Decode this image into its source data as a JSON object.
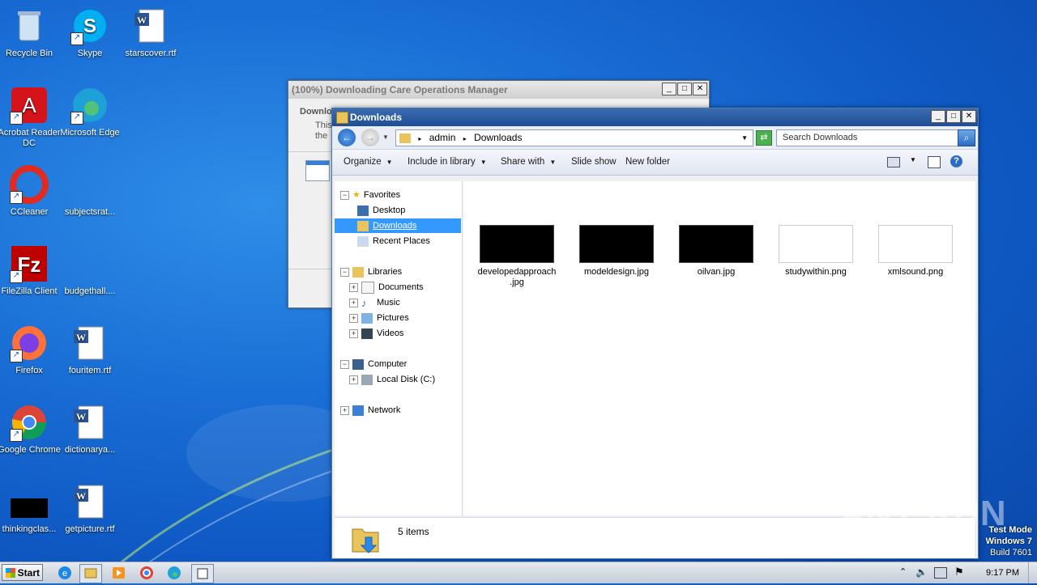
{
  "desktop": {
    "icons": [
      {
        "label": "Recycle Bin"
      },
      {
        "label": "Skype"
      },
      {
        "label": "starscover.rtf"
      },
      {
        "label": "Acrobat Reader DC"
      },
      {
        "label": "Microsoft Edge"
      },
      {
        "label": "CCleaner"
      },
      {
        "label": "subjectsrat..."
      },
      {
        "label": "FileZilla Client"
      },
      {
        "label": "budgethall...."
      },
      {
        "label": "Firefox"
      },
      {
        "label": "fouritem.rtf"
      },
      {
        "label": "Google Chrome"
      },
      {
        "label": "dictionarya..."
      },
      {
        "label": "thinkingclas..."
      },
      {
        "label": "getpicture.rtf"
      }
    ]
  },
  "background_window": {
    "title": "(100%) Downloading Care Operations Manager",
    "line1": "Downlo",
    "line2": "This",
    "line3": "the"
  },
  "explorer": {
    "title": "Downloads",
    "breadcrumb": [
      "admin",
      "Downloads"
    ],
    "search_placeholder": "Search Downloads",
    "commands": {
      "organize": "Organize",
      "include": "Include in library",
      "share": "Share with",
      "slideshow": "Slide show",
      "newfolder": "New folder"
    },
    "nav": {
      "favorites": "Favorites",
      "desktop": "Desktop",
      "downloads": "Downloads",
      "recent": "Recent Places",
      "libraries": "Libraries",
      "documents": "Documents",
      "music": "Music",
      "pictures": "Pictures",
      "videos": "Videos",
      "computer": "Computer",
      "localdisk": "Local Disk (C:)",
      "network": "Network"
    },
    "files": [
      {
        "name": "developedapproach.jpg",
        "line1": "developedapproach",
        "line2": ".jpg"
      },
      {
        "name": "modeldesign.jpg"
      },
      {
        "name": "oilvan.jpg"
      },
      {
        "name": "studywithin.png"
      },
      {
        "name": "xmlsound.png"
      }
    ],
    "status": "5 items"
  },
  "taskbar": {
    "start": "Start",
    "time": "9:17 PM"
  },
  "watermark": {
    "line1": "Test Mode",
    "line2": "Windows 7",
    "line3": "Build 7601",
    "brand": "ANY RUN"
  }
}
